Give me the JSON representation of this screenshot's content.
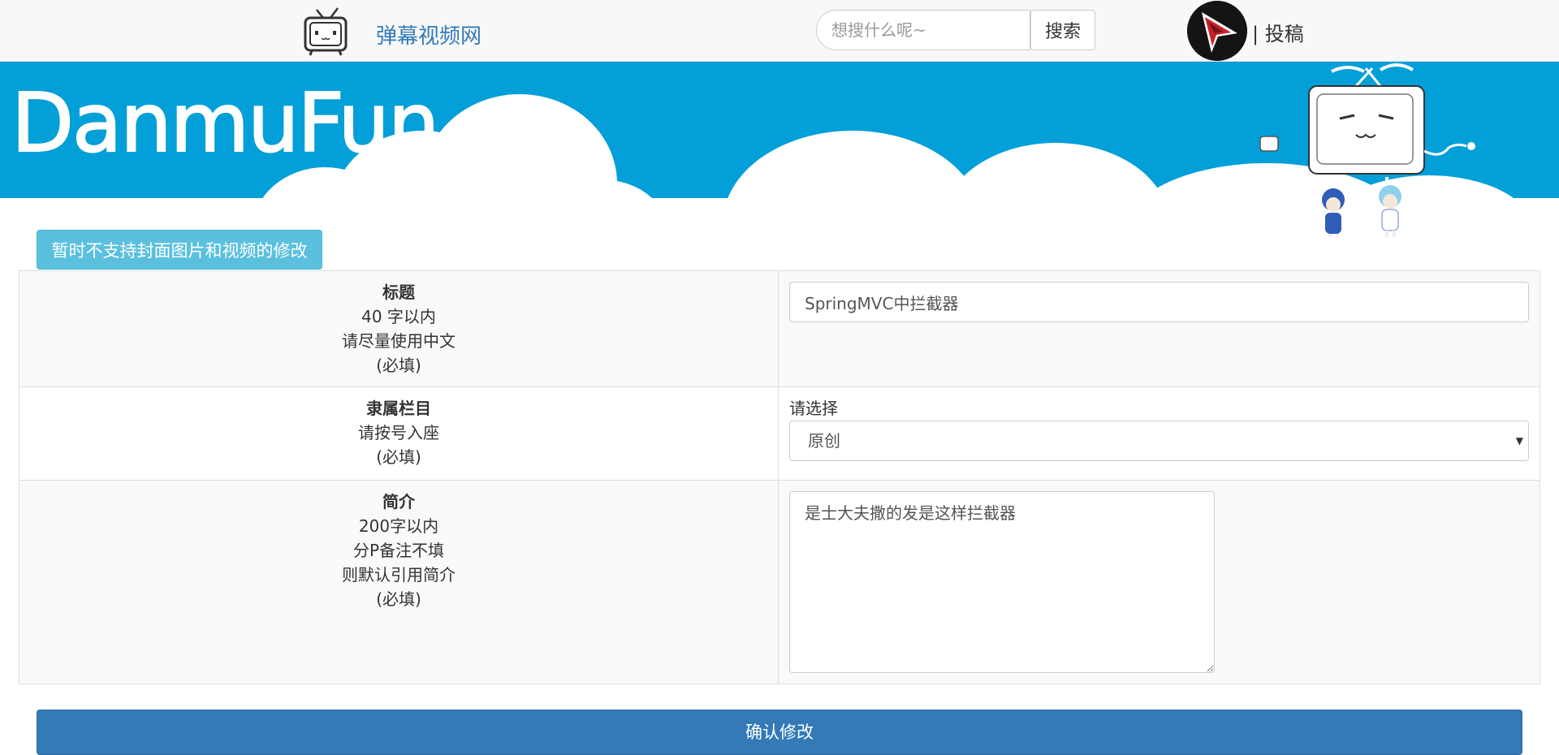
{
  "header": {
    "site_name": "弹幕视频网",
    "search_placeholder": "想搜什么呢~",
    "search_button": "搜索",
    "submit_link": "| 投稿"
  },
  "banner": {
    "logo_text": "DanmuFun"
  },
  "notice": {
    "label": "暂时不支持封面图片和视频的修改"
  },
  "form": {
    "title_row": {
      "heading": "标题",
      "lines": [
        "40 字以内",
        "请尽量使用中文",
        "(必填)"
      ],
      "value": "SpringMVC中拦截器"
    },
    "category_row": {
      "heading": "隶属栏目",
      "lines": [
        "请按号入座",
        "(必填)"
      ],
      "select_label": "请选择",
      "selected": "原创"
    },
    "desc_row": {
      "heading": "简介",
      "lines": [
        "200字以内",
        "分P备注不填",
        "则默认引用简介",
        "(必填)"
      ],
      "value": "是士大夫撒的发是这样拦截器"
    }
  },
  "confirm": {
    "label": "确认修改"
  },
  "colors": {
    "banner_blue": "#039fd8",
    "link_blue": "#337ab7",
    "info_button": "#5bc0de",
    "primary_button": "#337ab7"
  },
  "icons": {
    "site_logo": "tv-mascot-icon",
    "avatar": "cursor-arrow-avatar",
    "select_caret": "caret-down-icon"
  }
}
